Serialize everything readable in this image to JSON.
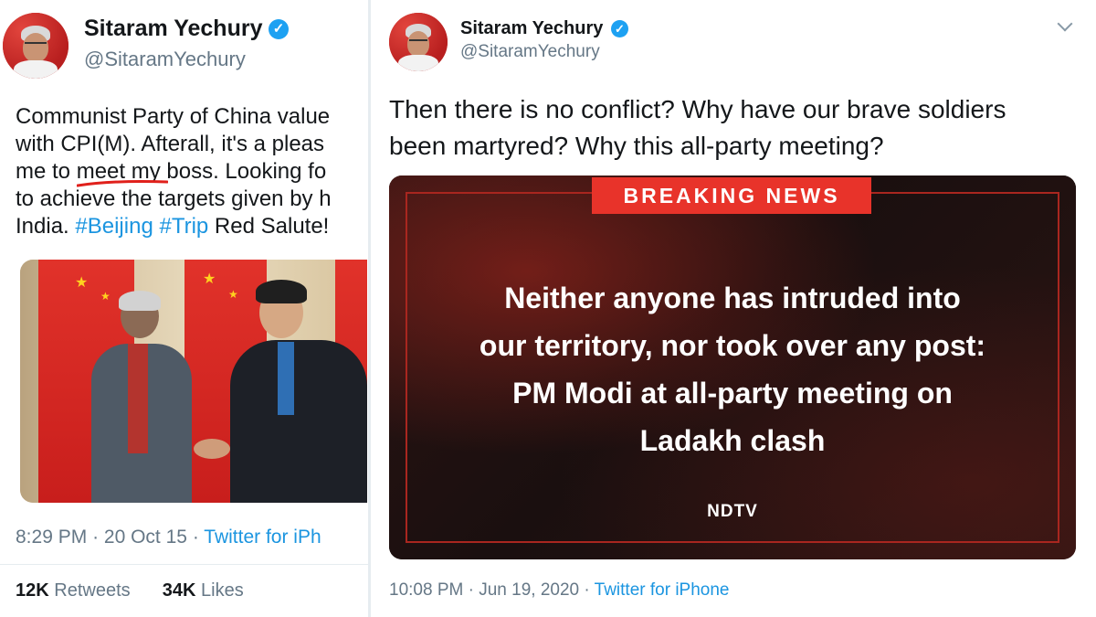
{
  "left_tweet": {
    "author_name": "Sitaram Yechury",
    "handle": "@SitaramYechury",
    "verified_glyph": "✓",
    "text_lines": [
      "Communist Party of China value",
      "with CPI(M). Afterall, it's a pleas",
      "me to ",
      "to achieve the targets given by h",
      "India. "
    ],
    "underlined_text": "meet my boss",
    "after_underline": ". Looking fo",
    "hashtags": [
      "#Beijing",
      "#Trip"
    ],
    "closing_text": " Red Salute!",
    "time": "8:29 PM",
    "separator": "·",
    "date": "20 Oct 15",
    "source": "Twitter for iPh",
    "retweets_count": "12K",
    "retweets_label": "Retweets",
    "likes_count": "34K",
    "likes_label": "Likes"
  },
  "right_tweet": {
    "author_name": "Sitaram Yechury",
    "handle": "@SitaramYechury",
    "verified_glyph": "✓",
    "text_lines": [
      "Then there is no conflict? Why have our brave soldiers",
      "been martyred? Why this all-party meeting?"
    ],
    "news_card": {
      "banner": "BREAKING NEWS",
      "headline_lines": [
        "Neither anyone has intruded into",
        "our territory, nor took over any post:",
        "PM Modi at all-party meeting on",
        "Ladakh clash"
      ],
      "logo_text": "NDTV"
    },
    "time": "10:08 PM",
    "separator": "·",
    "date": "Jun 19, 2020",
    "source": "Twitter for iPhone"
  },
  "colors": {
    "link_blue": "#1b95e0",
    "verified_blue": "#1da1f2",
    "breaking_red": "#e8332a",
    "secondary_gray": "#657786"
  },
  "icons": [
    "verified-badge-icon",
    "chevron-down-icon"
  ]
}
